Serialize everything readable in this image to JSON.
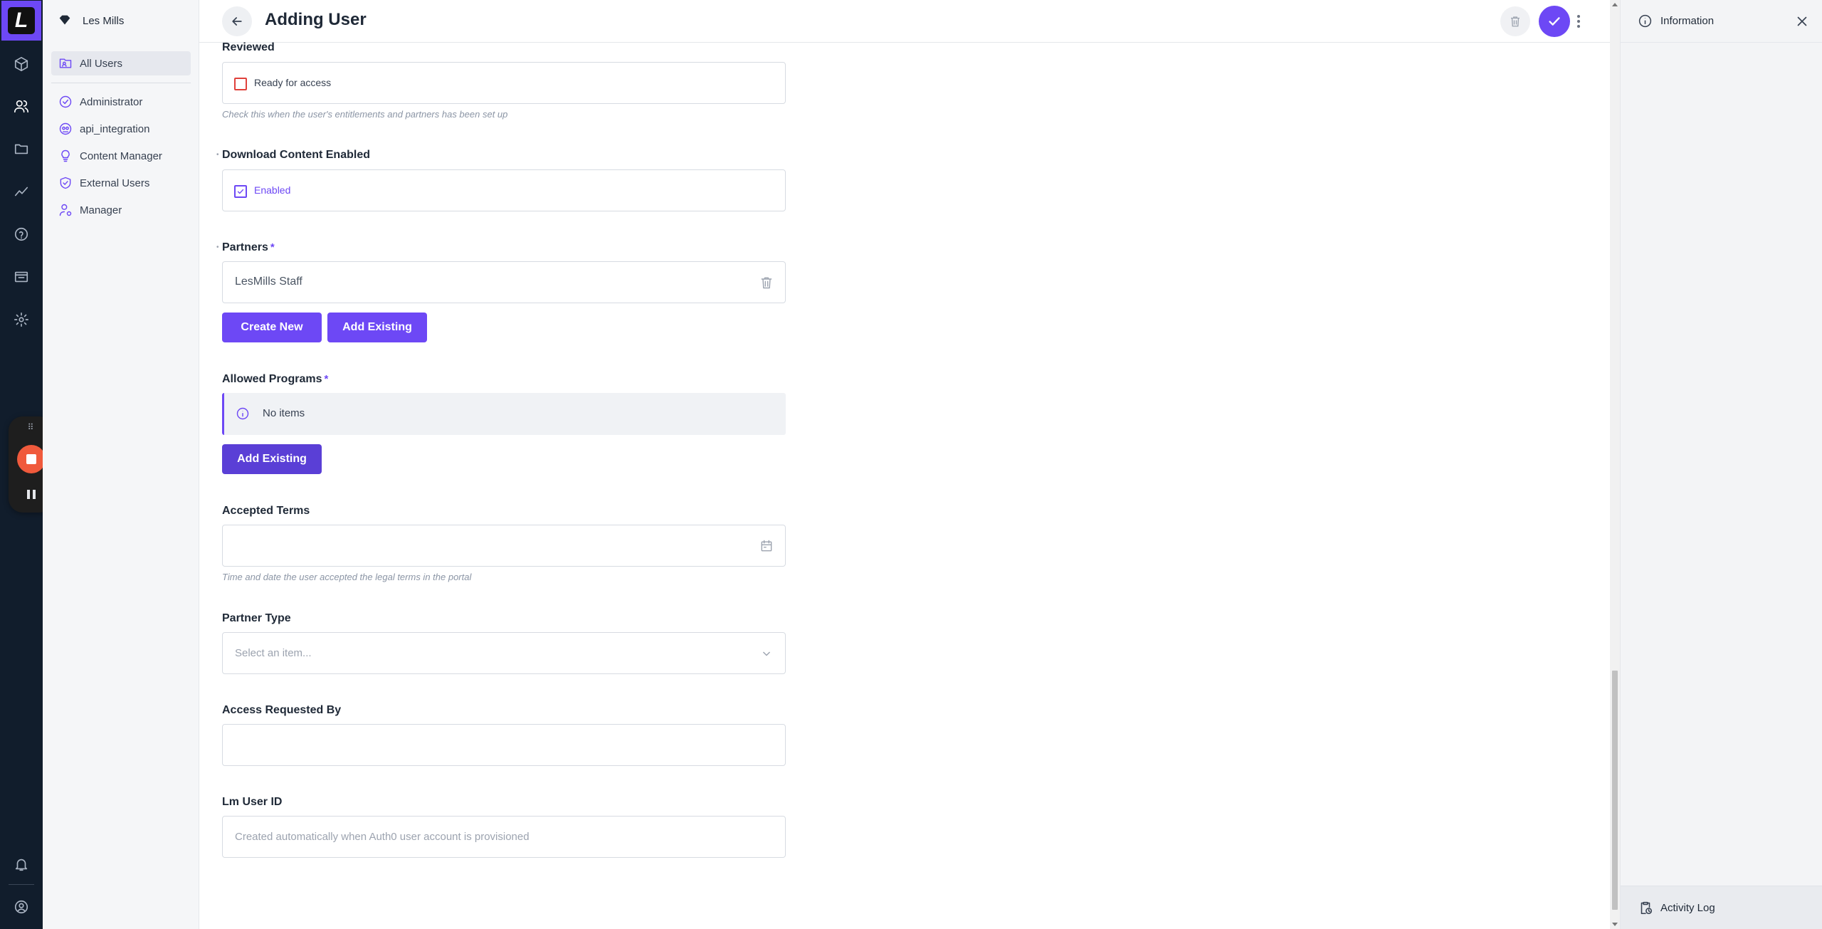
{
  "app": {
    "logo_letter": "L"
  },
  "rail": {
    "icons": [
      "box-icon",
      "users-icon",
      "folder-icon",
      "chart-icon",
      "help-icon",
      "media-icon",
      "settings-icon",
      "bell-icon",
      "account-icon"
    ],
    "active": "users-icon"
  },
  "sidebar": {
    "org_name": "Les Mills",
    "items": [
      {
        "label": "All Users",
        "icon": "users-folder-icon"
      },
      {
        "label": "Administrator",
        "icon": "badge-check-icon"
      },
      {
        "label": "api_integration",
        "icon": "api-icon"
      },
      {
        "label": "Content Manager",
        "icon": "lightbulb-icon"
      },
      {
        "label": "External Users",
        "icon": "shield-check-icon"
      },
      {
        "label": "Manager",
        "icon": "user-cog-icon"
      }
    ]
  },
  "header": {
    "title": "Adding User"
  },
  "form": {
    "reviewed": {
      "label": "Reviewed",
      "checkbox_label": "Ready for access",
      "checked": false,
      "hint": "Check this when the user's entitlements and partners has been set up"
    },
    "download": {
      "label": "Download Content Enabled",
      "checkbox_label": "Enabled",
      "checked": true
    },
    "partners": {
      "label": "Partners",
      "required_mark": "*",
      "value": "LesMills Staff",
      "create_label": "Create New",
      "add_label": "Add Existing"
    },
    "programs": {
      "label": "Allowed Programs",
      "required_mark": "*",
      "empty_text": "No items",
      "add_label": "Add Existing"
    },
    "terms": {
      "label": "Accepted Terms",
      "value": "",
      "hint": "Time and date the user accepted the legal terms in the portal"
    },
    "partner_type": {
      "label": "Partner Type",
      "placeholder": "Select an item..."
    },
    "requested_by": {
      "label": "Access Requested By",
      "value": ""
    },
    "lm_user_id": {
      "label": "Lm User ID",
      "placeholder": "Created automatically when Auth0 user account is provisioned"
    }
  },
  "info_panel": {
    "title": "Information",
    "footer_label": "Activity Log"
  },
  "colors": {
    "accent": "#6d48f5",
    "rail": "#111d2c",
    "record": "#f05a3c"
  }
}
